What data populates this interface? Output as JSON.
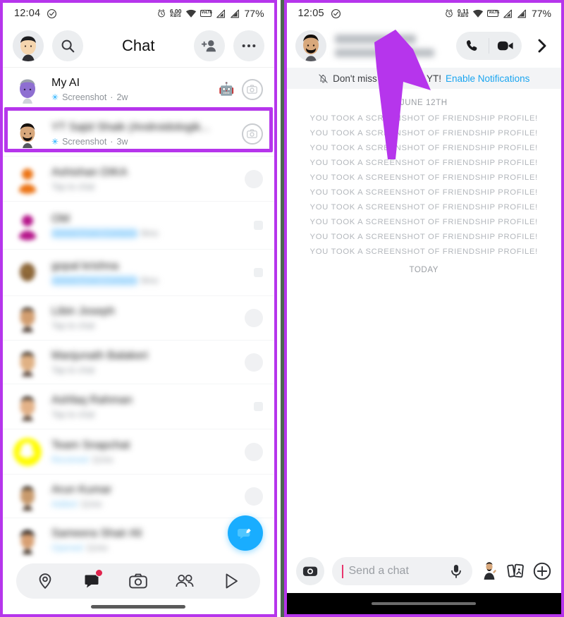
{
  "theme": {
    "highlight_purple": "#b635ec",
    "snap_blue": "#19adff",
    "accent_red": "#e0244d"
  },
  "left_panel": {
    "status_bar": {
      "time": "12:04",
      "net_speed_value": "6.00",
      "net_speed_unit": "KB/S",
      "volte_label": "VoLTE",
      "battery": "77%",
      "icons": [
        "alarm-clock-icon",
        "wifi-icon",
        "volte-icon",
        "signal-bars-icon",
        "signal-bars-icon"
      ]
    },
    "header": {
      "title": "Chat",
      "avatar": "profile-bitmoji-avatar",
      "search_icon": "search-icon",
      "add_friend_icon": "add-friend-icon",
      "more_icon": "more-options-icon"
    },
    "chat_rows": [
      {
        "name": "My AI",
        "status": "Screenshot",
        "time": "2w",
        "status_icon": "screenshot-icon",
        "blurred": false,
        "right": "camera",
        "extra_icon": "robot-icon",
        "avatar_color": "#9a7fd4"
      },
      {
        "name": "YT Sajid Shaik (Androidologik...",
        "status": "Screenshot",
        "time": "3w",
        "status_icon": "screenshot-icon",
        "blurred": true,
        "right": "camera",
        "extra_icon": "",
        "avatar_color": "#3b2a24",
        "highlighted": true
      },
      {
        "name": "Ashishan DIKA",
        "status": "Tap to chat",
        "time": "",
        "status_icon": "chat-icon",
        "blurred": true,
        "right": "circle",
        "extra_icon": "",
        "avatar_color": "#ec7415"
      },
      {
        "name": "OM",
        "status": "Joined From Contacts",
        "time": "8mo",
        "status_icon": "",
        "blurred": true,
        "right": "square",
        "extra_icon": "",
        "avatar_color": "#b5168a"
      },
      {
        "name": "gopal krishna",
        "status": "Joined From Contacts",
        "time": "8mo",
        "status_icon": "",
        "blurred": true,
        "right": "square",
        "extra_icon": "",
        "avatar_color": "#8a6437"
      },
      {
        "name": "Libin Joseph",
        "status": "Tap to chat",
        "time": "",
        "status_icon": "chat-icon",
        "blurred": true,
        "right": "circle",
        "extra_icon": "",
        "avatar_color": "#4a3a30"
      },
      {
        "name": "Manjunath Balakeri",
        "status": "Tap to chat",
        "time": "",
        "status_icon": "chat-icon",
        "blurred": true,
        "right": "circle",
        "extra_icon": "",
        "avatar_color": "#5b4434"
      },
      {
        "name": "Ashfaq Rahman",
        "status": "Tap to chat",
        "time": "",
        "status_icon": "chat-icon",
        "blurred": true,
        "right": "square",
        "extra_icon": "",
        "avatar_color": "#54402f"
      },
      {
        "name": "Team Snapchat",
        "status": "Received",
        "time": "11mo",
        "status_icon": "received-icon",
        "blurred": true,
        "right": "circle",
        "extra_icon": "",
        "avatar_color": "#fffc00"
      },
      {
        "name": "Arun Kumar",
        "status": "Added",
        "time": "11mo",
        "status_icon": "added-icon",
        "blurred": true,
        "right": "circle",
        "extra_icon": "",
        "avatar_color": "#4b3728"
      },
      {
        "name": "Sameera Shair Ali",
        "status": "Opened",
        "time": "11mo",
        "status_icon": "opened-icon",
        "blurred": true,
        "right": "fab",
        "extra_icon": "",
        "avatar_color": "#3a2b20"
      },
      {
        "name": "",
        "status": "",
        "time": "",
        "status_icon": "",
        "blurred": true,
        "right": "",
        "extra_icon": "",
        "avatar_color": "#2b2b2b"
      }
    ],
    "new_chat_fab": "new-chat-icon",
    "bottom_nav": [
      {
        "icon": "map-pin-icon",
        "active": false,
        "badge": false
      },
      {
        "icon": "chat-bubble-icon",
        "active": true,
        "badge": true
      },
      {
        "icon": "camera-icon",
        "active": false,
        "badge": false
      },
      {
        "icon": "friends-icon",
        "active": false,
        "badge": false
      },
      {
        "icon": "spotlight-play-icon",
        "active": false,
        "badge": false
      }
    ]
  },
  "right_panel": {
    "status_bar": {
      "time": "12:05",
      "net_speed_value": "0.11",
      "net_speed_unit": "KB/S",
      "volte_label": "VoLTE",
      "battery": "77%"
    },
    "conversation_header": {
      "avatar": "friend-bitmoji-avatar",
      "title_blurred": true,
      "call_icon": "phone-call-icon",
      "video_icon": "video-call-icon",
      "chevron_icon": "chevron-right-icon"
    },
    "notification_banner": {
      "icon": "notification-off-icon",
      "text": "Don't miss chats from YT!",
      "link": "Enable Notifications"
    },
    "messages": {
      "day_label_top": "JUNE 12TH",
      "screenshot_lines": [
        "YOU TOOK A SCREENSHOT OF FRIENDSHIP PROFILE!",
        "YOU TOOK A SCREENSHOT OF FRIENDSHIP PROFILE!",
        "YOU TOOK A SCREENSHOT OF FRIENDSHIP PROFILE!",
        "YOU TOOK A SCREENSHOT OF FRIENDSHIP PROFILE!",
        "YOU TOOK A SCREENSHOT OF FRIENDSHIP PROFILE!",
        "YOU TOOK A SCREENSHOT OF FRIENDSHIP PROFILE!",
        "YOU TOOK A SCREENSHOT OF FRIENDSHIP PROFILE!",
        "YOU TOOK A SCREENSHOT OF FRIENDSHIP PROFILE!",
        "YOU TOOK A SCREENSHOT OF FRIENDSHIP PROFILE!",
        "YOU TOOK A SCREENSHOT OF FRIENDSHIP PROFILE!"
      ],
      "day_label_bottom": "TODAY"
    },
    "composer": {
      "camera_icon": "camera-icon",
      "placeholder": "Send a chat",
      "mic_icon": "microphone-icon",
      "bitmoji_icon": "bitmoji-sticker-icon",
      "stickers_icon": "stickers-icon",
      "plus_icon": "add-attachment-icon"
    }
  },
  "annotation": {
    "arrow": "purple-up-arrow-annotation",
    "color": "#b635ec"
  }
}
